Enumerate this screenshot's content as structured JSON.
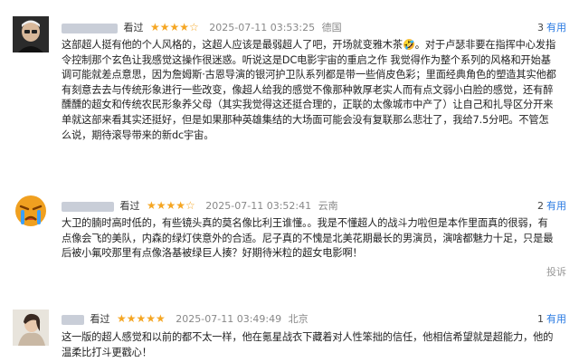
{
  "reviews": [
    {
      "tag": "看过",
      "stars": "★★★★☆",
      "time": "2025-07-11 03:53:25",
      "location": "德国",
      "useful_count": "3",
      "useful_label": "有用",
      "text": "这部超人挺有他的个人风格的，这超人应该是最弱超人了吧，开场就变雅木茶🤣。对于卢瑟非要在指挥中心发指令控制那个玄色让我感觉这操作很迷惑。听说这是DC电影宇宙的重启之作 我觉得作为整个系列的风格和开始基调可能就差点意思，因为詹姆斯·古恩导演的银河护卫队系列都是带一些俏皮色彩；里面经典角色的塑造其实他都有刻意去去与传统形象进行一些改变，像超人给我的感觉不像那种敦厚老实人而有点文弱小白脸的感觉，还有醉醺醺的超女和传统农民形象养父母（其实我觉得这还挺合理的，正联的太像城市中产了）让自己和扎导区分开来 单就这部来看其实还挺好，但是如果那种英雄集结的大场面可能会没有复联那么悲壮了，我给7.5分吧。不管怎么说，期待滚导带来的新dc宇宙。"
    },
    {
      "tag": "看过",
      "stars": "★★★★☆",
      "time": "2025-07-11 03:52:41",
      "location": "云南",
      "useful_count": "2",
      "useful_label": "有用",
      "report_label": "投诉",
      "text": "大卫的腩时高时低的，有些镜头真的莫名像比利王谁懂。。我是不懂超人的战斗力啦但是本作里面真的很弱，有点像会飞的美队，内森的绿灯侠意外的合适。尼子真的不愧是北美花期最长的男演员，演啥都魅力十足，只是最后被小氟咬那里有点像洛基被绿巨人揍？好期待米粒的超女电影啊！"
    },
    {
      "tag": "看过",
      "stars": "★★★★★",
      "time": "2025-07-11 03:49:49",
      "location": "北京",
      "useful_count": "1",
      "useful_label": "有用",
      "text": "这一版的超人感觉和以前的都不太一样，他在氪星战衣下藏着对人性笨拙的信任，他相信希望就是超能力，他的温柔比打斗更戳心！"
    }
  ]
}
